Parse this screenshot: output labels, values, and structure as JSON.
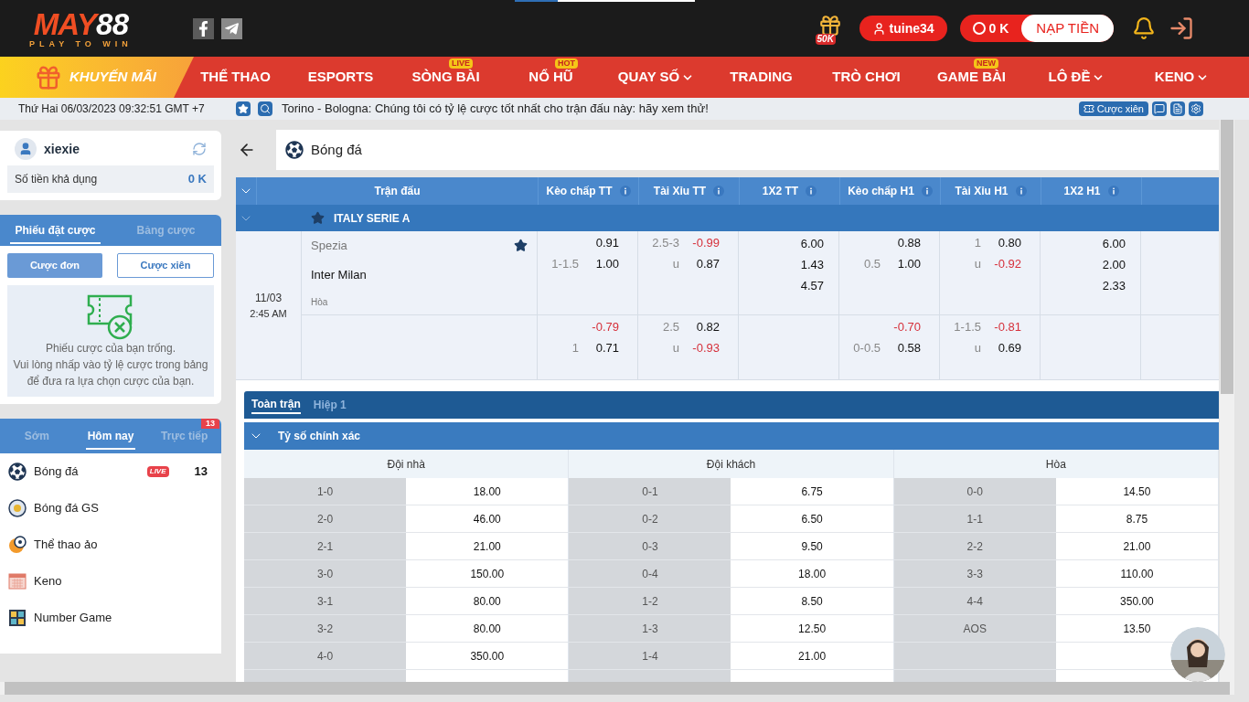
{
  "loading_bar": {
    "level": 0.24
  },
  "header": {
    "logo": {
      "parts": [
        "MAY",
        "88"
      ],
      "tagline": "PLAY TO WIN"
    },
    "promo_badge": "50K",
    "username": "tuine34",
    "balance": "0 K",
    "deposit_button": "NẠP TIỀN"
  },
  "nav": {
    "promo": "KHUYẾN MÃI",
    "items": [
      {
        "label": "THỂ THAO",
        "dropdown": false
      },
      {
        "label": "ESPORTS",
        "dropdown": false
      },
      {
        "label": "SÒNG BÀI",
        "badge": "LIVE",
        "dropdown": false
      },
      {
        "label": "NỔ HŨ",
        "badge": "HOT",
        "dropdown": false
      },
      {
        "label": "QUAY SỐ",
        "dropdown": true
      },
      {
        "label": "TRADING",
        "dropdown": false
      },
      {
        "label": "TRÒ CHƠI",
        "dropdown": false
      },
      {
        "label": "GAME BÀI",
        "badge": "NEW",
        "dropdown": false
      },
      {
        "label": "LÔ ĐỀ",
        "dropdown": true
      },
      {
        "label": "KENO",
        "dropdown": true
      }
    ]
  },
  "ticker": {
    "datetime": "Thứ Hai 06/03/2023 09:32:51 GMT +7",
    "message": "Torino - Bologna: Chúng tôi có tỷ lệ cược tốt nhất cho trận đấu này: hãy xem thử!",
    "parlay_button": "Cược xiên"
  },
  "sidebar": {
    "user": {
      "name": "xiexie",
      "balance_label": "Số tiền khả dụng",
      "balance": "0 K"
    },
    "slip_tabs": [
      {
        "label": "Phiếu đặt cược",
        "selected": true
      },
      {
        "label": "Bảng cược",
        "selected": false
      }
    ],
    "bet_types": [
      {
        "label": "Cược đơn",
        "selected": true
      },
      {
        "label": "Cược xiên",
        "selected": false
      }
    ],
    "empty_message": [
      "Phiếu cược của bạn trống.",
      "Vui lòng nhấp vào tỷ lệ cược trong bảng để đưa ra lựa chọn cược của bạn."
    ],
    "period_tabs": [
      {
        "label": "Sớm",
        "selected": false
      },
      {
        "label": "Hôm nay",
        "selected": true
      },
      {
        "label": "Trực tiếp",
        "selected": false,
        "badge": "13"
      }
    ],
    "sports": [
      {
        "kind": "soccer",
        "label": "Bóng đá",
        "live_badge": "LIVE",
        "count": "13"
      },
      {
        "kind": "soccer-gs",
        "label": "Bóng đá GS"
      },
      {
        "kind": "virtual",
        "label": "Thể thao ảo"
      },
      {
        "kind": "keno",
        "label": "Keno"
      },
      {
        "kind": "number",
        "label": "Number Game"
      }
    ]
  },
  "main": {
    "breadcrumb": "Bóng đá",
    "columns": [
      "Trận đấu",
      "Kèo chấp TT",
      "Tài Xỉu TT",
      "1X2 TT",
      "Kèo chấp H1",
      "Tài Xỉu H1",
      "1X2 H1"
    ],
    "league": {
      "name": "ITALY SERIE A",
      "favorite": true
    },
    "match": {
      "date": "11/03",
      "time": "2:45 AM",
      "home": "Spezia",
      "away": "Inter Milan",
      "draw": "Hòa",
      "favorite": true,
      "lines": [
        {
          "handicap_ft": [
            {
              "odd": "0.91",
              "negative": false
            },
            {
              "line": "1-1.5",
              "odd": "1.00",
              "negative": false
            }
          ],
          "ou_ft": [
            {
              "line": "2.5-3",
              "odd": "-0.99",
              "negative": true
            },
            {
              "line": "u",
              "odd": "0.87",
              "negative": false
            }
          ],
          "x12_ft": [
            "6.00",
            "1.43",
            "4.57"
          ],
          "handicap_h1": [
            {
              "odd": "0.88",
              "negative": false
            },
            {
              "line": "0.5",
              "odd": "1.00",
              "negative": false
            }
          ],
          "ou_h1": [
            {
              "line": "1",
              "odd": "0.80",
              "negative": false
            },
            {
              "line": "u",
              "odd": "-0.92",
              "negative": true
            }
          ],
          "x12_h1": [
            "6.00",
            "2.00",
            "2.33"
          ]
        },
        {
          "handicap_ft": [
            {
              "odd": "-0.79",
              "negative": true
            },
            {
              "line": "1",
              "odd": "0.71",
              "negative": false
            }
          ],
          "ou_ft": [
            {
              "line": "2.5",
              "odd": "0.82",
              "negative": false
            },
            {
              "line": "u",
              "odd": "-0.93",
              "negative": true
            }
          ],
          "handicap_h1": [
            {
              "odd": "-0.70",
              "negative": true
            },
            {
              "line": "0-0.5",
              "odd": "0.58",
              "negative": false
            }
          ],
          "ou_h1": [
            {
              "line": "1-1.5",
              "odd": "-0.81",
              "negative": true
            },
            {
              "line": "u",
              "odd": "0.69",
              "negative": false
            }
          ]
        }
      ]
    }
  },
  "scores": {
    "tabs": [
      {
        "label": "Toàn trận",
        "selected": true
      },
      {
        "label": "Hiệp 1",
        "selected": false
      }
    ],
    "title": "Tỷ số chính xác",
    "groups": [
      {
        "heading": "Đội nhà",
        "rows": [
          [
            "1-0",
            "18.00"
          ],
          [
            "2-0",
            "46.00"
          ],
          [
            "2-1",
            "21.00"
          ],
          [
            "3-0",
            "150.00"
          ],
          [
            "3-1",
            "80.00"
          ],
          [
            "3-2",
            "80.00"
          ],
          [
            "4-0",
            "350.00"
          ]
        ]
      },
      {
        "heading": "Đội khách",
        "rows": [
          [
            "0-1",
            "6.75"
          ],
          [
            "0-2",
            "6.50"
          ],
          [
            "0-3",
            "9.50"
          ],
          [
            "0-4",
            "18.00"
          ],
          [
            "1-2",
            "8.50"
          ],
          [
            "1-3",
            "12.50"
          ],
          [
            "1-4",
            "21.00"
          ]
        ]
      },
      {
        "heading": "Hòa",
        "rows": [
          [
            "0-0",
            "14.50"
          ],
          [
            "1-1",
            "8.75"
          ],
          [
            "2-2",
            "21.00"
          ],
          [
            "3-3",
            "110.00"
          ],
          [
            "4-4",
            "350.00"
          ],
          [
            "AOS",
            "13.50"
          ]
        ]
      }
    ]
  }
}
